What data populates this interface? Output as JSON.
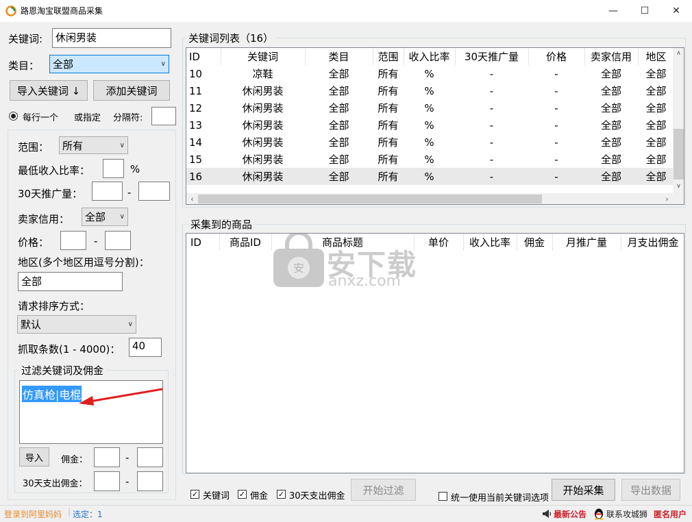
{
  "window": {
    "title": "路恩淘宝联盟商品采集",
    "min": "—",
    "max": "☐",
    "close": "✕"
  },
  "left": {
    "keyword_label": "关键词:",
    "keyword_value": "休闲男装",
    "category_label": "类目：",
    "category_value": "全部",
    "import_keyword_btn": "导入关键词 ↓",
    "add_keyword_btn": "添加关键词",
    "per_line_label": "每行一个",
    "or_specify_label": "或指定",
    "separator_label": "分隔符:",
    "separator_value": "",
    "scope_label": "范围：",
    "scope_value": "所有",
    "min_ratio_label": "最低收入比率：",
    "min_ratio_value": "",
    "percent": "%",
    "promo30_label": "30天推广量：",
    "promo30_from": "",
    "dash": "-",
    "promo30_to": "",
    "seller_credit_label": "卖家信用：",
    "seller_credit_value": "全部",
    "price_label": "价格：",
    "price_from": "",
    "price_to": "",
    "region_label": "地区(多个地区用逗号分割)：",
    "region_value": "全部",
    "sort_label": "请求排序方式：",
    "sort_value": "默认",
    "fetch_label": "抓取条数(1 - 4000)：",
    "fetch_value": "40",
    "filter_group_title": "过滤关键词及佣金",
    "filter_text": "仿真枪|电棍",
    "filter_import_btn": "导入",
    "commission_label": "佣金：",
    "commission_from": "",
    "commission_to": "",
    "spend30_label": "30天支出佣金：",
    "spend30_from": "",
    "spend30_to": ""
  },
  "keyword_list": {
    "title": "关键词列表（16）",
    "columns": [
      "ID",
      "关键词",
      "类目",
      "范围",
      "收入比率",
      "30天推广量",
      "价格",
      "卖家信用",
      "地区"
    ],
    "rows": [
      [
        "10",
        "凉鞋",
        "全部",
        "所有",
        "%",
        "-",
        "-",
        "全部",
        "全部"
      ],
      [
        "11",
        "休闲男装",
        "全部",
        "所有",
        "%",
        "-",
        "-",
        "全部",
        "全部"
      ],
      [
        "12",
        "休闲男装",
        "全部",
        "所有",
        "%",
        "-",
        "-",
        "全部",
        "全部"
      ],
      [
        "13",
        "休闲男装",
        "全部",
        "所有",
        "%",
        "-",
        "-",
        "全部",
        "全部"
      ],
      [
        "14",
        "休闲男装",
        "全部",
        "所有",
        "%",
        "-",
        "-",
        "全部",
        "全部"
      ],
      [
        "15",
        "休闲男装",
        "全部",
        "所有",
        "%",
        "-",
        "-",
        "全部",
        "全部"
      ],
      [
        "16",
        "休闲男装",
        "全部",
        "所有",
        "%",
        "-",
        "-",
        "全部",
        "全部"
      ]
    ],
    "selected_row": 6
  },
  "products": {
    "title": "采集到的商品",
    "columns": [
      "ID",
      "商品ID",
      "商品标题",
      "单价",
      "收入比率",
      "佣金",
      "月推广量",
      "月支出佣金"
    ],
    "watermark_main": "安下载",
    "watermark_sub": "anxz.com"
  },
  "bottom": {
    "cb_keyword": "关键词",
    "cb_commission": "佣金",
    "cb_spend30": "30天支出佣金",
    "start_filter_btn": "开始过滤",
    "unify_option": "统一使用当前关键词选项",
    "start_collect_btn": "开始采集",
    "export_btn": "导出数据"
  },
  "status": {
    "login": "登录到阿里妈妈",
    "selected": "选定：1",
    "news": "最新公告",
    "contact": "联系攻城狮",
    "anon": "匿名用户"
  },
  "colors": {
    "status_orange": "#e8892a",
    "status_blue": "#2a6fc9",
    "status_red": "#d0202a",
    "select_blue": "#cce8ff",
    "highlight": "#3399ff"
  }
}
